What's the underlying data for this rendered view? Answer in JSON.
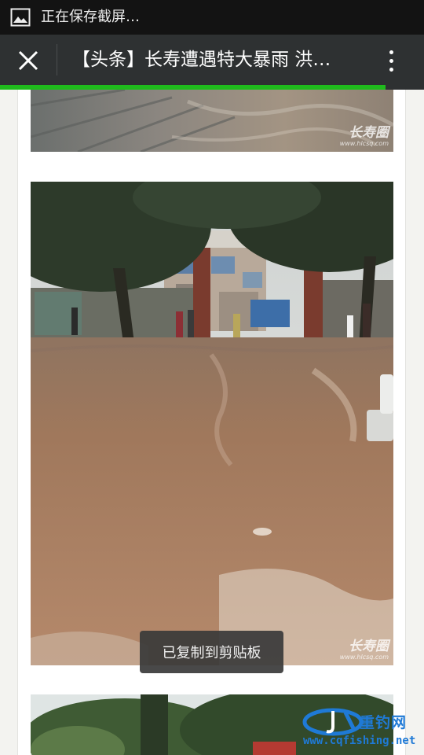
{
  "status_bar": {
    "notification_text": "正在保存截屏…",
    "icon": "image-icon"
  },
  "title_bar": {
    "title": "【头条】长寿遭遇特大暴雨 洪…",
    "close_icon": "close-icon",
    "menu_icon": "more-vert-icon",
    "load_progress": 0.91
  },
  "article": {
    "images": [
      {
        "watermark": "长寿圈",
        "watermark_url": "www.hlcsq.com"
      },
      {
        "watermark": "长寿圈",
        "watermark_url": "www.hlcsq.com"
      },
      {
        "watermark": ""
      }
    ]
  },
  "toast": {
    "message": "已复制到剪贴板"
  },
  "site_logo": {
    "name": "重钓网",
    "url": "www.cqfishing.net"
  },
  "colors": {
    "accent_green": "#1fba1c",
    "toolbar": "#2e3132",
    "status_bar": "#131313",
    "logo_blue": "#1f7ad6"
  }
}
